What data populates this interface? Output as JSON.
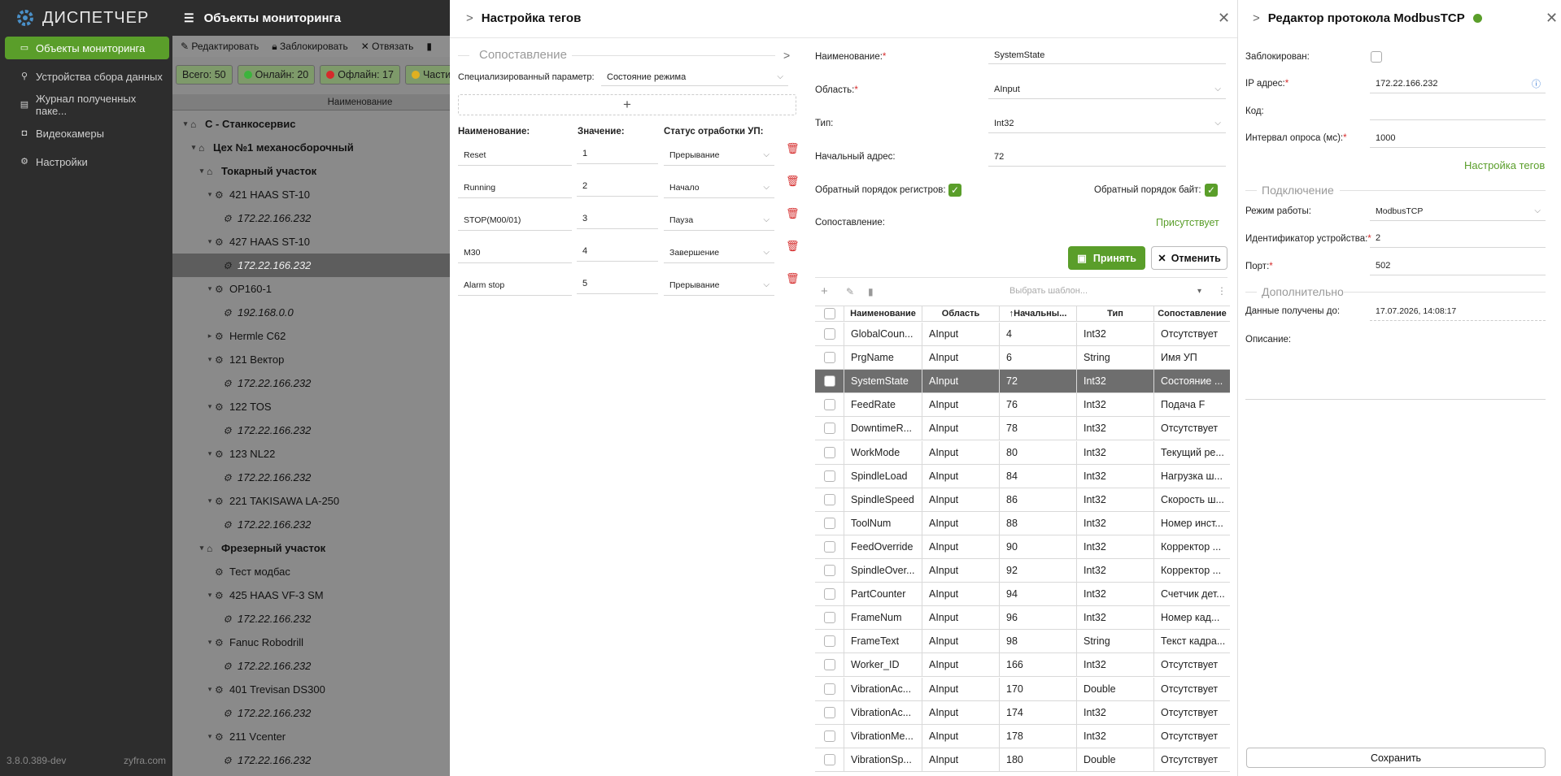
{
  "sidebar": {
    "logo": "ДИСПЕТЧЕР",
    "items": [
      {
        "label": "Объекты мониторинга",
        "icon": "monitor-icon",
        "active": true
      },
      {
        "label": "Устройства сбора данных",
        "icon": "network-icon"
      },
      {
        "label": "Журнал полученных паке...",
        "icon": "document-icon"
      },
      {
        "label": "Видеокамеры",
        "icon": "camera-icon"
      },
      {
        "label": "Настройки",
        "icon": "gear-icon"
      }
    ],
    "version": "3.8.0.389-dev",
    "brand": "zyfra.com"
  },
  "main": {
    "title": "Объекты мониторинга",
    "toolbar": {
      "edit": "Редактировать",
      "block": "Заблокировать",
      "unbind": "Отвязать"
    },
    "stats": {
      "total": "Всего: 50",
      "online": "Онлайн: 20",
      "offline": "Офлайн: 17",
      "partial": "Части"
    },
    "tree_header": "Наименование",
    "tree": [
      {
        "label": "С - Станкосервис",
        "level": 0,
        "bold": true,
        "icon": "home-icon"
      },
      {
        "label": "Цех №1 механосборочный",
        "level": 1,
        "bold": true,
        "icon": "home-icon"
      },
      {
        "label": "Токарный участок",
        "level": 2,
        "bold": true,
        "icon": "home-icon"
      },
      {
        "label": "421 HAAS ST-10",
        "level": 3,
        "icon": "gear-icon"
      },
      {
        "label": "172.22.166.232",
        "level": 4,
        "italic": true,
        "icon": "gear-icon"
      },
      {
        "label": "427 HAAS ST-10",
        "level": 3,
        "icon": "gear-icon"
      },
      {
        "label": "172.22.166.232",
        "level": 4,
        "italic": true,
        "icon": "gear-icon",
        "selected": true
      },
      {
        "label": "OP160-1",
        "level": 3,
        "icon": "gear-icon"
      },
      {
        "label": "192.168.0.0",
        "level": 4,
        "italic": true,
        "icon": "gear-icon"
      },
      {
        "label": "Hermle C62",
        "level": 3,
        "icon": "gear-icon",
        "collapsed": true
      },
      {
        "label": "121 Вектор",
        "level": 3,
        "icon": "gear-icon"
      },
      {
        "label": "172.22.166.232",
        "level": 4,
        "italic": true,
        "icon": "gear-icon"
      },
      {
        "label": "122 TOS",
        "level": 3,
        "icon": "gear-icon"
      },
      {
        "label": "172.22.166.232",
        "level": 4,
        "italic": true,
        "icon": "gear-icon"
      },
      {
        "label": "123 NL22",
        "level": 3,
        "icon": "gear-icon"
      },
      {
        "label": "172.22.166.232",
        "level": 4,
        "italic": true,
        "icon": "gear-icon"
      },
      {
        "label": "221 TAKISAWA LA-250",
        "level": 3,
        "icon": "gear-icon"
      },
      {
        "label": "172.22.166.232",
        "level": 4,
        "italic": true,
        "icon": "gear-icon"
      },
      {
        "label": "Фрезерный участок",
        "level": 2,
        "bold": true,
        "icon": "home-icon"
      },
      {
        "label": "Тест модбас",
        "level": 3,
        "icon": "gear-icon",
        "leaf": true
      },
      {
        "label": "425 HAAS VF-3 SM",
        "level": 3,
        "icon": "gear-icon"
      },
      {
        "label": "172.22.166.232",
        "level": 4,
        "italic": true,
        "icon": "gear-icon"
      },
      {
        "label": "Fanuc Robodrill",
        "level": 3,
        "icon": "gear-icon"
      },
      {
        "label": "172.22.166.232",
        "level": 4,
        "italic": true,
        "icon": "gear-icon"
      },
      {
        "label": "401 Trevisan DS300",
        "level": 3,
        "icon": "gear-icon"
      },
      {
        "label": "172.22.166.232",
        "level": 4,
        "italic": true,
        "icon": "gear-icon"
      },
      {
        "label": "211 Vcenter",
        "level": 3,
        "icon": "gear-icon"
      },
      {
        "label": "172.22.166.232",
        "level": 4,
        "italic": true,
        "icon": "gear-icon"
      }
    ]
  },
  "tags": {
    "title": "Настройка тегов",
    "mapping_section": "Сопоставление",
    "special_param_label": "Специализированный параметр:",
    "special_param_value": "Состояние режима",
    "map_cols": {
      "name": "Наименование:",
      "value": "Значение:",
      "status": "Статус отработки УП:"
    },
    "map_rows": [
      {
        "name": "Reset",
        "value": "1",
        "status": "Прерывание"
      },
      {
        "name": "Running",
        "value": "2",
        "status": "Начало"
      },
      {
        "name": "STOP(M00/01)",
        "value": "3",
        "status": "Пауза"
      },
      {
        "name": "M30",
        "value": "4",
        "status": "Завершение"
      },
      {
        "name": "Alarm stop",
        "value": "5",
        "status": "Прерывание"
      }
    ],
    "form": {
      "name_label": "Наименование:",
      "name_value": "SystemState",
      "area_label": "Область:",
      "area_value": "AInput",
      "type_label": "Тип:",
      "type_value": "Int32",
      "addr_label": "Начальный адрес:",
      "addr_value": "72",
      "reg_order_label": "Обратный порядок регистров:",
      "byte_order_label": "Обратный порядок байт:",
      "mapping_label": "Сопоставление:",
      "mapping_value": "Присутствует",
      "required": "*"
    },
    "accept": "Принять",
    "cancel": "Отменить",
    "template_placeholder": "Выбрать шаблон...",
    "table": {
      "columns": [
        "Наименование",
        "Область",
        "Начальны...",
        "Тип",
        "Сопоставление"
      ],
      "rows": [
        [
          "GlobalCoun...",
          "AInput",
          "4",
          "Int32",
          "Отсутствует"
        ],
        [
          "PrgName",
          "AInput",
          "6",
          "String",
          "Имя УП"
        ],
        [
          "SystemState",
          "AInput",
          "72",
          "Int32",
          "Состояние ..."
        ],
        [
          "FeedRate",
          "AInput",
          "76",
          "Int32",
          "Подача F"
        ],
        [
          "DowntimeR...",
          "AInput",
          "78",
          "Int32",
          "Отсутствует"
        ],
        [
          "WorkMode",
          "AInput",
          "80",
          "Int32",
          "Текущий ре..."
        ],
        [
          "SpindleLoad",
          "AInput",
          "84",
          "Int32",
          "Нагрузка ш..."
        ],
        [
          "SpindleSpeed",
          "AInput",
          "86",
          "Int32",
          "Скорость ш..."
        ],
        [
          "ToolNum",
          "AInput",
          "88",
          "Int32",
          "Номер инст..."
        ],
        [
          "FeedOverride",
          "AInput",
          "90",
          "Int32",
          "Корректор ..."
        ],
        [
          "SpindleOver...",
          "AInput",
          "92",
          "Int32",
          "Корректор ..."
        ],
        [
          "PartCounter",
          "AInput",
          "94",
          "Int32",
          "Счетчик дет..."
        ],
        [
          "FrameNum",
          "AInput",
          "96",
          "Int32",
          "Номер кад..."
        ],
        [
          "FrameText",
          "AInput",
          "98",
          "String",
          "Текст кадра..."
        ],
        [
          "Worker_ID",
          "AInput",
          "166",
          "Int32",
          "Отсутствует"
        ],
        [
          "VibrationAc...",
          "AInput",
          "170",
          "Double",
          "Отсутствует"
        ],
        [
          "VibrationAc...",
          "AInput",
          "174",
          "Int32",
          "Отсутствует"
        ],
        [
          "VibrationMe...",
          "AInput",
          "178",
          "Int32",
          "Отсутствует"
        ],
        [
          "VibrationSp...",
          "AInput",
          "180",
          "Double",
          "Отсутствует"
        ]
      ],
      "selected_index": 2
    }
  },
  "modbus": {
    "title": "Редактор протокола ModbusTCP",
    "status_color": "#5a9e2a",
    "blocked_label": "Заблокирован:",
    "ip_label": "IP адрес:",
    "ip_value": "172.22.166.232",
    "code_label": "Код:",
    "interval_label": "Интервал опроса (мс):",
    "interval_value": "1000",
    "tags_link": "Настройка тегов",
    "connection_section": "Подключение",
    "mode_label": "Режим работы:",
    "mode_value": "ModbusTCP",
    "device_id_label": "Идентификатор устройства:",
    "device_id_value": "2",
    "port_label": "Порт:",
    "port_value": "502",
    "extra_section": "Дополнительно",
    "data_until_label": "Данные получены до:",
    "data_until_value": "17.07.2026, 14:08:17",
    "description_label": "Описание:",
    "save": "Сохранить",
    "required": "*"
  }
}
